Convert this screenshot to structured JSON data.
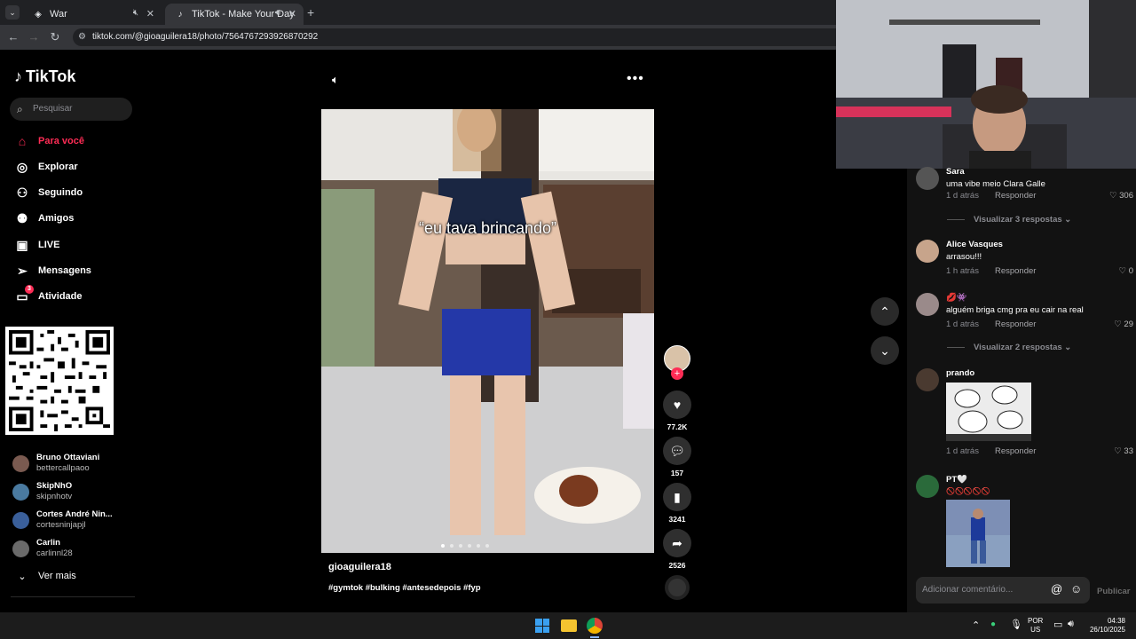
{
  "tabs": [
    {
      "title": "War",
      "active": false
    },
    {
      "title": "TikTok - Make Your Day",
      "active": true
    }
  ],
  "address": {
    "url": "tiktok.com/@gioaguilera18/photo/7564767293926870292"
  },
  "sidebar": {
    "logo": "TikTok",
    "search_placeholder": "Pesquisar",
    "nav": [
      {
        "label": "Para você",
        "icon": "home-icon"
      },
      {
        "label": "Explorar",
        "icon": "compass-icon"
      },
      {
        "label": "Seguindo",
        "icon": "following-icon"
      },
      {
        "label": "Amigos",
        "icon": "friends-icon"
      },
      {
        "label": "LIVE",
        "icon": "live-icon"
      },
      {
        "label": "Mensagens",
        "icon": "messages-icon"
      },
      {
        "label": "Atividade",
        "icon": "activity-icon",
        "badge": "3"
      }
    ],
    "accounts": [
      {
        "name": "Bruno Ottaviani",
        "user": "bettercallpaoo"
      },
      {
        "name": "SkipNhO",
        "user": "skipnhotv"
      },
      {
        "name": "Cortes André Nin...",
        "user": "cortesninjapjl"
      },
      {
        "name": "Carlin",
        "user": "carlinnl28"
      }
    ],
    "see_more": "Ver mais"
  },
  "post": {
    "overlay_text": "“eu tava brincando”",
    "author": "gioaguilera18",
    "hashtags": "#gymtok #bulking #antesedepois #fyp",
    "likes": "77.2K",
    "comments": "157",
    "saves": "3241",
    "shares": "2526"
  },
  "comments": [
    {
      "name": "Sara",
      "text": "uma vibe meio Clara Galle",
      "time": "1 d atrás",
      "likes": "306",
      "replies": "Visualizar 3 respostas"
    },
    {
      "name": "Alice Vasques",
      "text": "arrasou!!!",
      "time": "1 h atrás",
      "likes": "0"
    },
    {
      "name": "💋👾",
      "text": "alguém briga cmg pra eu cair na real",
      "time": "1 d atrás",
      "likes": "29",
      "replies": "Visualizar 2 respostas"
    },
    {
      "name": "prando",
      "text": "",
      "time": "1 d atrás",
      "likes": "33"
    },
    {
      "name": "PT🤍",
      "text": "🚫🚫🚫🚫🚫",
      "time": "",
      "likes": ""
    }
  ],
  "reply_label": "Responder",
  "comment_input": {
    "placeholder": "Adicionar comentário...",
    "publish": "Publicar"
  },
  "taskbar": {
    "lang": "POR",
    "region": "US",
    "time": "04:38",
    "date": "26/10/2025"
  }
}
